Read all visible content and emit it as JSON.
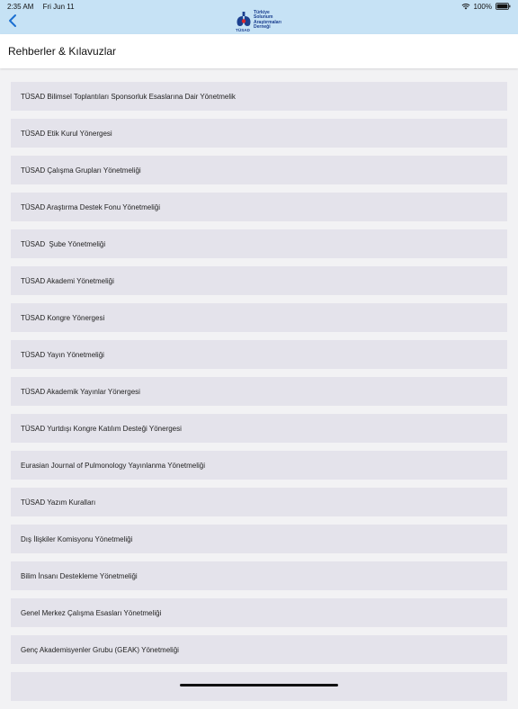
{
  "status_bar": {
    "time": "2:35 AM",
    "date": "Fri Jun 11",
    "battery": "100%"
  },
  "nav": {
    "back_icon": "chevron-left-icon",
    "logo": {
      "abbrev": "TÜSAD",
      "lines": [
        "Türkiye",
        "Solunum",
        "Araştırmaları",
        "Derneği"
      ]
    }
  },
  "header": {
    "title": "Rehberler & Kılavuzlar"
  },
  "list": {
    "items": [
      "TÜSAD Bilimsel Toplantıları Sponsorluk Esaslarına Dair Yönetmelik",
      "TÜSAD Etik Kurul Yönergesi",
      "TÜSAD Çalışma Grupları Yönetmeliği",
      "TÜSAD Araştırma Destek Fonu Yönetmeliği",
      "TÜSAD  Şube Yönetmeliği",
      "TÜSAD Akademi Yönetmeliği",
      "TÜSAD Kongre Yönergesi",
      "TÜSAD Yayın Yönetmeliği",
      "TÜSAD Akademik Yayınlar Yönergesi",
      "TÜSAD Yurtdışı Kongre Katılım Desteği Yönergesi",
      "Eurasian Journal of Pulmonology Yayınlanma Yönetmeliği",
      "TÜSAD Yazım Kuralları",
      "Dış İlişkiler Komisyonu Yönetmeliği",
      "Bilim İnsanı Destekleme Yönetmeliği",
      "Genel Merkez Çalışma Esasları Yönetmeliği",
      "Genç Akademisyenler Grubu (GEAK) Yönetmeliği",
      ""
    ]
  },
  "colors": {
    "nav_bg": "#c6e2f5",
    "accent": "#1b6fd1",
    "item_bg": "#e4e3eb",
    "page_bg": "#f2f2f4"
  }
}
